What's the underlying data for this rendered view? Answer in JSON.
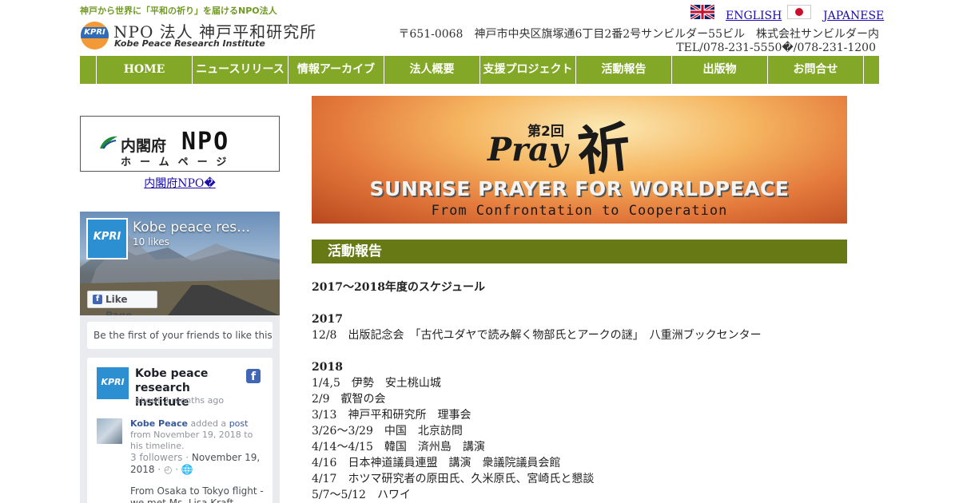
{
  "header": {
    "tagline": "神戸から世界に「平和の祈り」を届けるNPO法人",
    "logo_text": "KPRI",
    "org_title": "NPO 法人  神戸平和研究所",
    "org_subtitle": "Kobe Peace Research Institute",
    "lang_english": "ENGLISH",
    "lang_japanese": "JAPANESE",
    "address": "〒651-0068　神戸市中央区旗塚通6丁目2番2号サンビルダー55ビル　株式会社サンビルダー内",
    "tel": "TEL/078-231-5550�/078-231-1200"
  },
  "nav": {
    "items": [
      "HOME",
      "ニュースリリース",
      "情報アーカイブ",
      "法人概要",
      "支援プロジェクト",
      "活動報告",
      "出版物",
      "お問合せ"
    ]
  },
  "colors": {
    "nav_bg": "#83a827",
    "section_head_bg": "#667914",
    "tagline": "#6f9a22",
    "link": "#1a0dab"
  },
  "sidebar": {
    "npo_banner_line1": "内閣府",
    "npo_banner_npo": "NPO",
    "npo_banner_line2": "ホームページ",
    "npo_link": "内閣府NPO�",
    "facebook": {
      "page_name": "Kobe peace res…",
      "likes": "10 likes",
      "avatar_text": "KPRI",
      "like_button": "Like Page",
      "friends_text": "Be the first of your friends to like this",
      "post_author": "Kobe peace research institute",
      "post_time": "about 3 months ago",
      "share_author": "Kobe Peace",
      "share_text_1": "added a",
      "share_link": "post",
      "share_text_2": "from November 19, 2018 to his timeline.",
      "share_followers": "3 followers · ",
      "share_date": "November 19, 2018",
      "share_date_suffix": " · ◴ · 🌐",
      "post_body": "From Osaka to Tokyo flight - we met Ms. Lisa Kraft, Peac..."
    }
  },
  "main": {
    "banner": {
      "kai": "第2回",
      "pray": "Pray",
      "inori": "祈",
      "title": "SUNRISE PRAYER FOR WORLDPEACE",
      "subtitle": "From Confrontation to Cooperation"
    },
    "section_title": "活動報告",
    "schedule_title": "2017～2018年度のスケジュール",
    "year_2017": "2017",
    "items_2017": [
      "12/8　出版記念会　「古代ユダヤで読み解く物部氏とアークの謎」　八重洲ブックセンター"
    ],
    "year_2018": "2018",
    "items_2018": [
      "1/4,5　伊勢　安土桃山城",
      "2/9　叡智の会",
      "3/13　神戸平和研究所　理事会",
      "3/26～3/29　中国　北京訪問",
      "4/14～4/15　韓国　済州島　講演",
      "4/16　日本神道議員連盟　講演　衆議院議員会館",
      "4/17　ホツマ研究者の原田氏、久米原氏、宮崎氏と懇談",
      "5/7～5/12　ハワイ"
    ]
  }
}
